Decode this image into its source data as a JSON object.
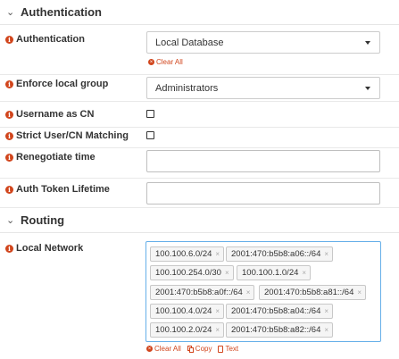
{
  "sections": {
    "authentication": {
      "title": "Authentication"
    },
    "routing": {
      "title": "Routing"
    }
  },
  "fields": {
    "authentication": {
      "label": "Authentication",
      "value": "Local Database",
      "clear_label": "Clear All"
    },
    "enforce_local_group": {
      "label": "Enforce local group",
      "value": "Administrators"
    },
    "username_as_cn": {
      "label": "Username as CN",
      "checked": false
    },
    "strict_user_cn": {
      "label": "Strict User/CN Matching",
      "checked": false
    },
    "renegotiate_time": {
      "label": "Renegotiate time",
      "value": ""
    },
    "auth_token_lifetime": {
      "label": "Auth Token Lifetime",
      "value": ""
    },
    "local_network": {
      "label": "Local Network",
      "tags": [
        "100.100.6.0/24",
        "2001:470:b5b8:a06::/64",
        "100.100.254.0/30",
        "100.100.1.0/24",
        "2001:470:b5b8:a0f::/64",
        "2001:470:b5b8:a81::/64",
        "100.100.4.0/24",
        "2001:470:b5b8:a04::/64",
        "100.100.2.0/24",
        "2001:470:b5b8:a82::/64"
      ],
      "tag_remove_glyph": "×",
      "actions": {
        "clear_all": "Clear All",
        "copy": "Copy",
        "text": "Text"
      }
    }
  },
  "icons": {
    "section_chevron": "chevron-down-icon",
    "info": "info-icon",
    "accent_color": "#d1451c"
  }
}
